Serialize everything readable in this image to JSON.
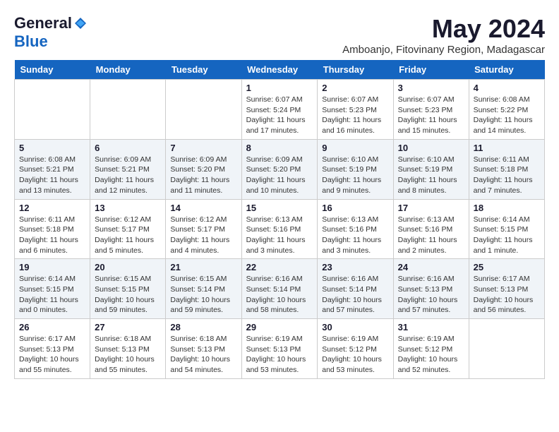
{
  "header": {
    "logo_general": "General",
    "logo_blue": "Blue",
    "month_title": "May 2024",
    "subtitle": "Amboanjo, Fitovinany Region, Madagascar"
  },
  "weekdays": [
    "Sunday",
    "Monday",
    "Tuesday",
    "Wednesday",
    "Thursday",
    "Friday",
    "Saturday"
  ],
  "weeks": [
    [
      {
        "day": "",
        "info": ""
      },
      {
        "day": "",
        "info": ""
      },
      {
        "day": "",
        "info": ""
      },
      {
        "day": "1",
        "info": "Sunrise: 6:07 AM\nSunset: 5:24 PM\nDaylight: 11 hours and 17 minutes."
      },
      {
        "day": "2",
        "info": "Sunrise: 6:07 AM\nSunset: 5:23 PM\nDaylight: 11 hours and 16 minutes."
      },
      {
        "day": "3",
        "info": "Sunrise: 6:07 AM\nSunset: 5:23 PM\nDaylight: 11 hours and 15 minutes."
      },
      {
        "day": "4",
        "info": "Sunrise: 6:08 AM\nSunset: 5:22 PM\nDaylight: 11 hours and 14 minutes."
      }
    ],
    [
      {
        "day": "5",
        "info": "Sunrise: 6:08 AM\nSunset: 5:21 PM\nDaylight: 11 hours and 13 minutes."
      },
      {
        "day": "6",
        "info": "Sunrise: 6:09 AM\nSunset: 5:21 PM\nDaylight: 11 hours and 12 minutes."
      },
      {
        "day": "7",
        "info": "Sunrise: 6:09 AM\nSunset: 5:20 PM\nDaylight: 11 hours and 11 minutes."
      },
      {
        "day": "8",
        "info": "Sunrise: 6:09 AM\nSunset: 5:20 PM\nDaylight: 11 hours and 10 minutes."
      },
      {
        "day": "9",
        "info": "Sunrise: 6:10 AM\nSunset: 5:19 PM\nDaylight: 11 hours and 9 minutes."
      },
      {
        "day": "10",
        "info": "Sunrise: 6:10 AM\nSunset: 5:19 PM\nDaylight: 11 hours and 8 minutes."
      },
      {
        "day": "11",
        "info": "Sunrise: 6:11 AM\nSunset: 5:18 PM\nDaylight: 11 hours and 7 minutes."
      }
    ],
    [
      {
        "day": "12",
        "info": "Sunrise: 6:11 AM\nSunset: 5:18 PM\nDaylight: 11 hours and 6 minutes."
      },
      {
        "day": "13",
        "info": "Sunrise: 6:12 AM\nSunset: 5:17 PM\nDaylight: 11 hours and 5 minutes."
      },
      {
        "day": "14",
        "info": "Sunrise: 6:12 AM\nSunset: 5:17 PM\nDaylight: 11 hours and 4 minutes."
      },
      {
        "day": "15",
        "info": "Sunrise: 6:13 AM\nSunset: 5:16 PM\nDaylight: 11 hours and 3 minutes."
      },
      {
        "day": "16",
        "info": "Sunrise: 6:13 AM\nSunset: 5:16 PM\nDaylight: 11 hours and 3 minutes."
      },
      {
        "day": "17",
        "info": "Sunrise: 6:13 AM\nSunset: 5:16 PM\nDaylight: 11 hours and 2 minutes."
      },
      {
        "day": "18",
        "info": "Sunrise: 6:14 AM\nSunset: 5:15 PM\nDaylight: 11 hours and 1 minute."
      }
    ],
    [
      {
        "day": "19",
        "info": "Sunrise: 6:14 AM\nSunset: 5:15 PM\nDaylight: 11 hours and 0 minutes."
      },
      {
        "day": "20",
        "info": "Sunrise: 6:15 AM\nSunset: 5:15 PM\nDaylight: 10 hours and 59 minutes."
      },
      {
        "day": "21",
        "info": "Sunrise: 6:15 AM\nSunset: 5:14 PM\nDaylight: 10 hours and 59 minutes."
      },
      {
        "day": "22",
        "info": "Sunrise: 6:16 AM\nSunset: 5:14 PM\nDaylight: 10 hours and 58 minutes."
      },
      {
        "day": "23",
        "info": "Sunrise: 6:16 AM\nSunset: 5:14 PM\nDaylight: 10 hours and 57 minutes."
      },
      {
        "day": "24",
        "info": "Sunrise: 6:16 AM\nSunset: 5:13 PM\nDaylight: 10 hours and 57 minutes."
      },
      {
        "day": "25",
        "info": "Sunrise: 6:17 AM\nSunset: 5:13 PM\nDaylight: 10 hours and 56 minutes."
      }
    ],
    [
      {
        "day": "26",
        "info": "Sunrise: 6:17 AM\nSunset: 5:13 PM\nDaylight: 10 hours and 55 minutes."
      },
      {
        "day": "27",
        "info": "Sunrise: 6:18 AM\nSunset: 5:13 PM\nDaylight: 10 hours and 55 minutes."
      },
      {
        "day": "28",
        "info": "Sunrise: 6:18 AM\nSunset: 5:13 PM\nDaylight: 10 hours and 54 minutes."
      },
      {
        "day": "29",
        "info": "Sunrise: 6:19 AM\nSunset: 5:13 PM\nDaylight: 10 hours and 53 minutes."
      },
      {
        "day": "30",
        "info": "Sunrise: 6:19 AM\nSunset: 5:12 PM\nDaylight: 10 hours and 53 minutes."
      },
      {
        "day": "31",
        "info": "Sunrise: 6:19 AM\nSunset: 5:12 PM\nDaylight: 10 hours and 52 minutes."
      },
      {
        "day": "",
        "info": ""
      }
    ]
  ]
}
